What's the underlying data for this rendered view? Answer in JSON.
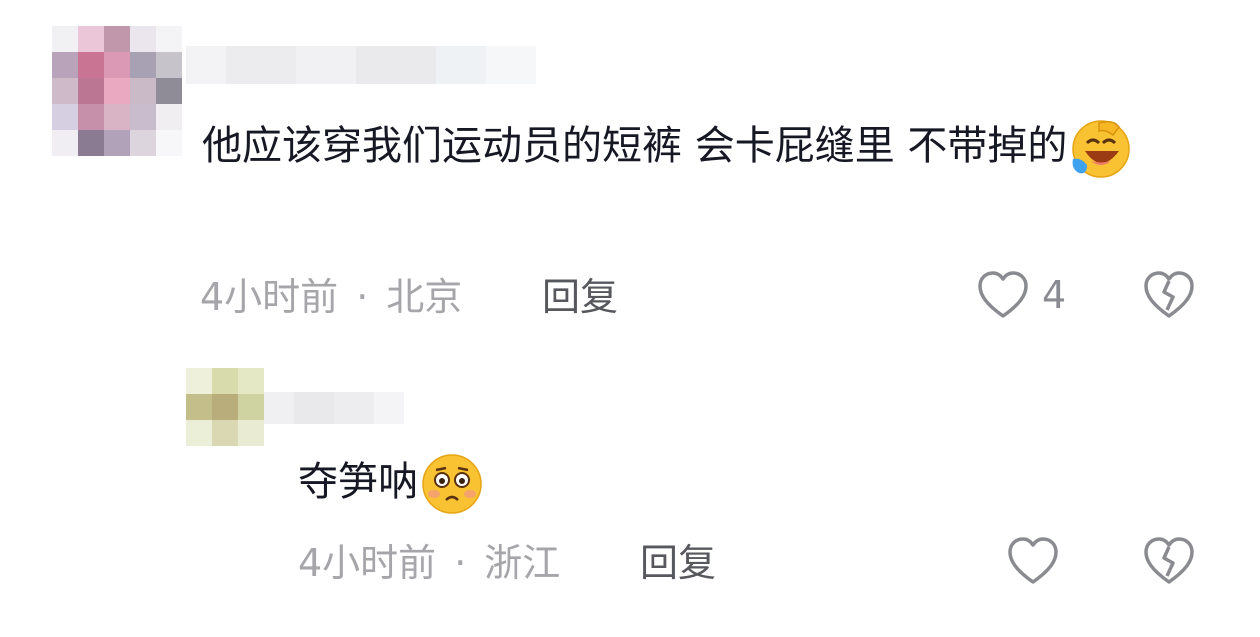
{
  "comments": [
    {
      "text": "他应该穿我们运动员的短裤 会卡屁缝里 不带掉的",
      "emoji": "laughing-crying-emoji",
      "time": "4小时前",
      "separator": "·",
      "location": "北京",
      "reply_label": "回复",
      "like_count": "4",
      "avatar_colors": [
        "#f1f0f3",
        "#e9c6d8",
        "#bf97ab",
        "#ebe6ee",
        "#f4f4f6",
        "#b8a3b9",
        "#c57592",
        "#d99ab4",
        "#a7a1b2",
        "#c6c4ca",
        "#cdbac8",
        "#b87792",
        "#e8aac1",
        "#c9b9c6",
        "#8f8c97",
        "#d6cfe0",
        "#c490a9",
        "#d7b4c4",
        "#c9bccb",
        "#f1eef2",
        "#f0eef2",
        "#8a7b91",
        "#b1a2b8",
        "#dcd5de",
        "#f7f6f8"
      ]
    },
    {
      "text": "夺笋呐",
      "emoji": "pleading-face-emoji",
      "time": "4小时前",
      "separator": "·",
      "location": "浙江",
      "reply_label": "回复",
      "like_count": "",
      "avatar_colors": [
        "#eef0dc",
        "#d8dcae",
        "#e4e8c6",
        "#c4bf8c",
        "#b9ad7e",
        "#cfd3a4",
        "#ecefd9",
        "#d9d8b4",
        "#e9ebd3"
      ]
    }
  ],
  "colors": {
    "text": "#161823",
    "meta": "#a6a6aa",
    "reply": "#57585e",
    "icon": "#8a8b91"
  }
}
